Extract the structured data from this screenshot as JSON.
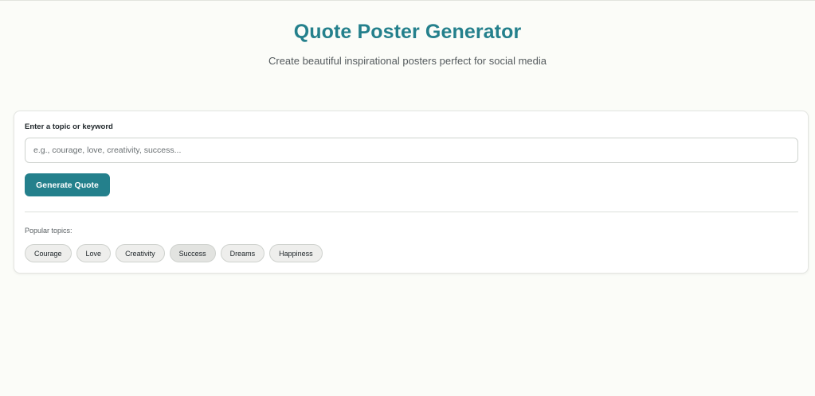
{
  "header": {
    "title": "Quote Poster Generator",
    "subtitle": "Create beautiful inspirational posters perfect for social media"
  },
  "form": {
    "label": "Enter a topic or keyword",
    "input_value": "",
    "input_placeholder": "e.g., courage, love, creativity, success...",
    "generate_label": "Generate Quote"
  },
  "popular": {
    "label": "Popular topics:",
    "topics": [
      "Courage",
      "Love",
      "Creativity",
      "Success",
      "Dreams",
      "Happiness"
    ]
  },
  "colors": {
    "accent": "#24808c",
    "background": "#fbfcf8",
    "chip_background": "#eeeeec"
  }
}
